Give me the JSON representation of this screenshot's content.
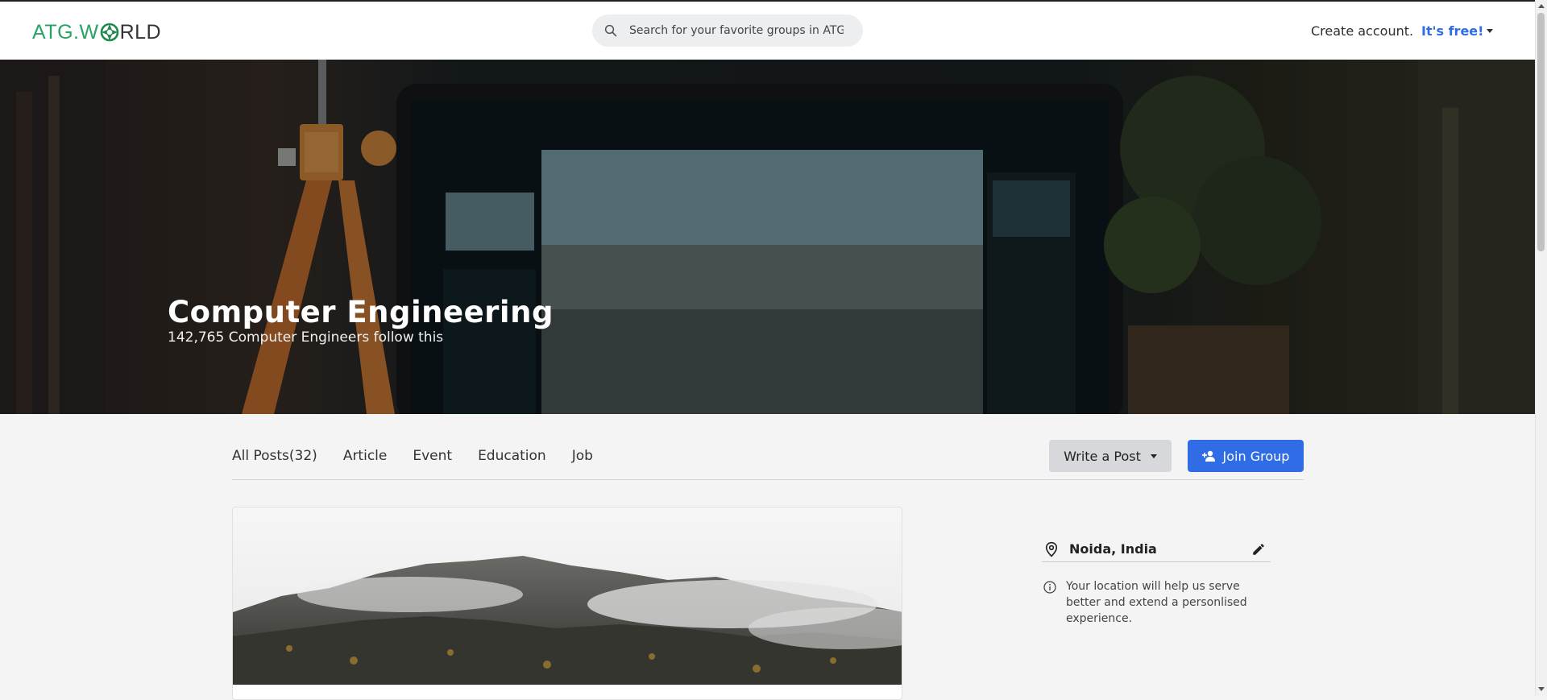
{
  "header": {
    "logo_prefix": "ATG.W",
    "logo_suffix": "RLD",
    "search_placeholder": "Search for your favorite groups in ATG",
    "create_account": "Create account.",
    "its_free": "It's free!"
  },
  "hero": {
    "title": "Computer Engineering",
    "subtitle": "142,765 Computer Engineers follow this"
  },
  "tabs": [
    {
      "label": "All Posts(32)"
    },
    {
      "label": "Article"
    },
    {
      "label": "Event"
    },
    {
      "label": "Education"
    },
    {
      "label": "Job"
    }
  ],
  "actions": {
    "write_post": "Write a Post",
    "join_group": "Join Group"
  },
  "location": {
    "city": "Noida, India",
    "info": "Your location will help us serve better and extend a personlised experience."
  },
  "colors": {
    "brand_green": "#27a365",
    "accent_blue": "#2f6ce5"
  }
}
